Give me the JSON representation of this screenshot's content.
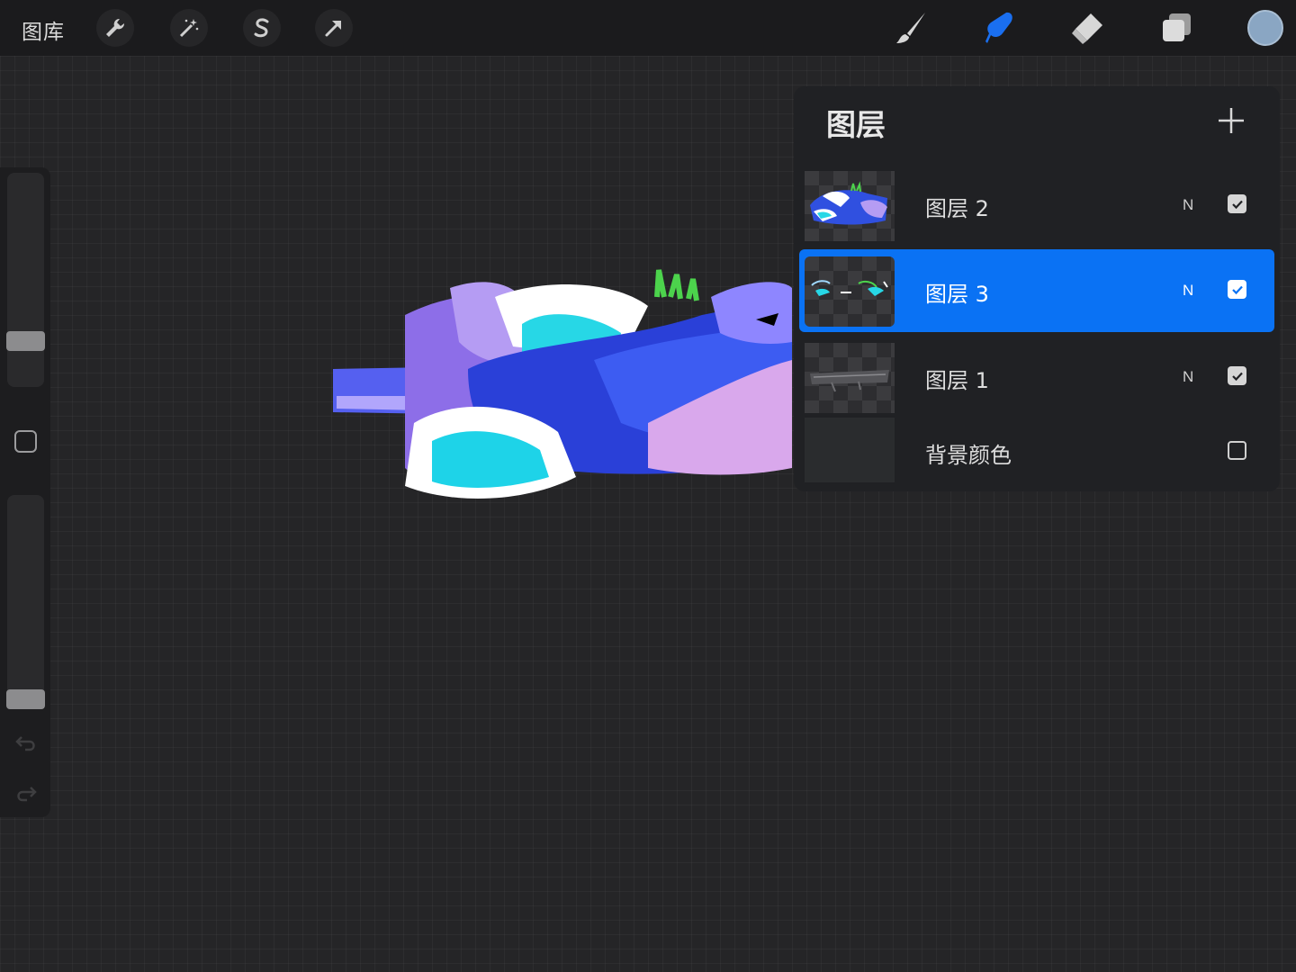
{
  "toolbar": {
    "gallery_label": "图库",
    "left_tools": [
      "wrench-icon",
      "magic-wand-icon",
      "selection-s-icon",
      "transform-arrow-icon"
    ],
    "right_tools": [
      "brush-icon",
      "smudge-icon",
      "eraser-icon",
      "layers-icon"
    ],
    "active_tool": "smudge-icon",
    "accent_color": "#0a72f4",
    "current_color": "#8aa6c3"
  },
  "sidebar": {
    "size_slider_value": 0.05,
    "opacity_slider_value": 0.05
  },
  "layers_panel": {
    "title": "图层",
    "add_icon": "plus-icon",
    "layers": [
      {
        "name": "图层 2",
        "blend": "N",
        "visible": true,
        "active": false
      },
      {
        "name": "图层 3",
        "blend": "N",
        "visible": true,
        "active": true
      },
      {
        "name": "图层 1",
        "blend": "N",
        "visible": true,
        "active": false
      },
      {
        "name": "背景颜色",
        "blend": "",
        "visible": false,
        "active": false
      }
    ]
  }
}
